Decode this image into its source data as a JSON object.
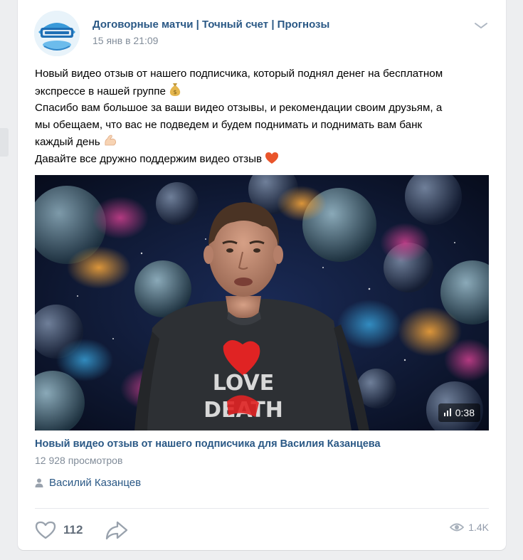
{
  "post": {
    "author": "Договорные матчи | Точный счет | Прогнозы",
    "date": "15 янв в 21:09",
    "text_lines": [
      "Новый видео отзыв от нашего подписчика, который поднял денег на бесплатном",
      "экспрессе в нашей группе",
      "Спасибо вам большое за ваши видео отзывы, и рекомендации своим друзьям, а",
      "мы обещаем, что вас не подведем и будем поднимать и поднимать вам банк",
      "каждый день",
      "Давайте все дружно поддержим видео отзыв"
    ],
    "avatar_icon": "group-logo",
    "menu_icon": "chevron-down-icon"
  },
  "video": {
    "duration": "0:38",
    "shirt_text_1": "LOVE",
    "shirt_text_2": "DEATH",
    "title": "Новый видео отзыв от нашего подписчика для Василия Казанцева",
    "views": "12 928 просмотров",
    "author": "Василий Казанцев"
  },
  "actions": {
    "likes": "112",
    "views": "1.4K"
  },
  "colors": {
    "link": "#2a5885",
    "secondary": "#818c99",
    "icon": "#99a2ad",
    "background": "#edeef0"
  }
}
